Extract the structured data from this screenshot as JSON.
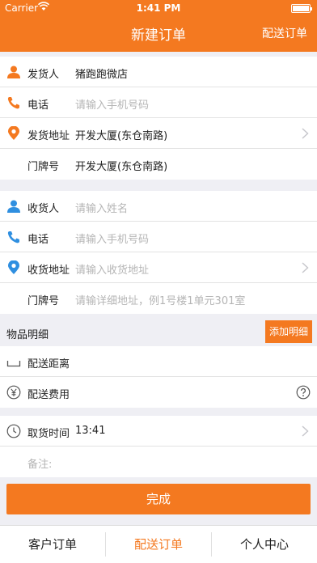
{
  "status_bar": {
    "carrier": "Carrier",
    "time": "1:41 PM"
  },
  "nav": {
    "title": "新建订单",
    "right_action": "配送订单"
  },
  "sender": {
    "name_label": "发货人",
    "name_value": "猪跑跑微店",
    "phone_label": "电话",
    "phone_placeholder": "请输入手机号码",
    "address_label": "发货地址",
    "address_value": "开发大厦(东仓南路)",
    "door_label": "门牌号",
    "door_value": "开发大厦(东仓南路)"
  },
  "receiver": {
    "name_label": "收货人",
    "name_placeholder": "请输入姓名",
    "phone_label": "电话",
    "phone_placeholder": "请输入手机号码",
    "address_label": "收货地址",
    "address_placeholder": "请输入收货地址",
    "door_label": "门牌号",
    "door_placeholder": "请输详细地址，例1号楼1单元301室"
  },
  "items": {
    "title": "物品明细",
    "add_label": "添加明细"
  },
  "delivery": {
    "distance_label": "配送距离",
    "fee_label": "配送费用"
  },
  "pickup": {
    "time_label": "取货时间",
    "time_value": "13:41",
    "note_placeholder": "备注:"
  },
  "actions": {
    "done_label": "完成"
  },
  "tabs": [
    {
      "label": "客户订单"
    },
    {
      "label": "配送订单"
    },
    {
      "label": "个人中心"
    }
  ],
  "colors": {
    "accent": "#f47920",
    "sender_icon": "#f47920",
    "receiver_icon": "#2f8fe0"
  }
}
